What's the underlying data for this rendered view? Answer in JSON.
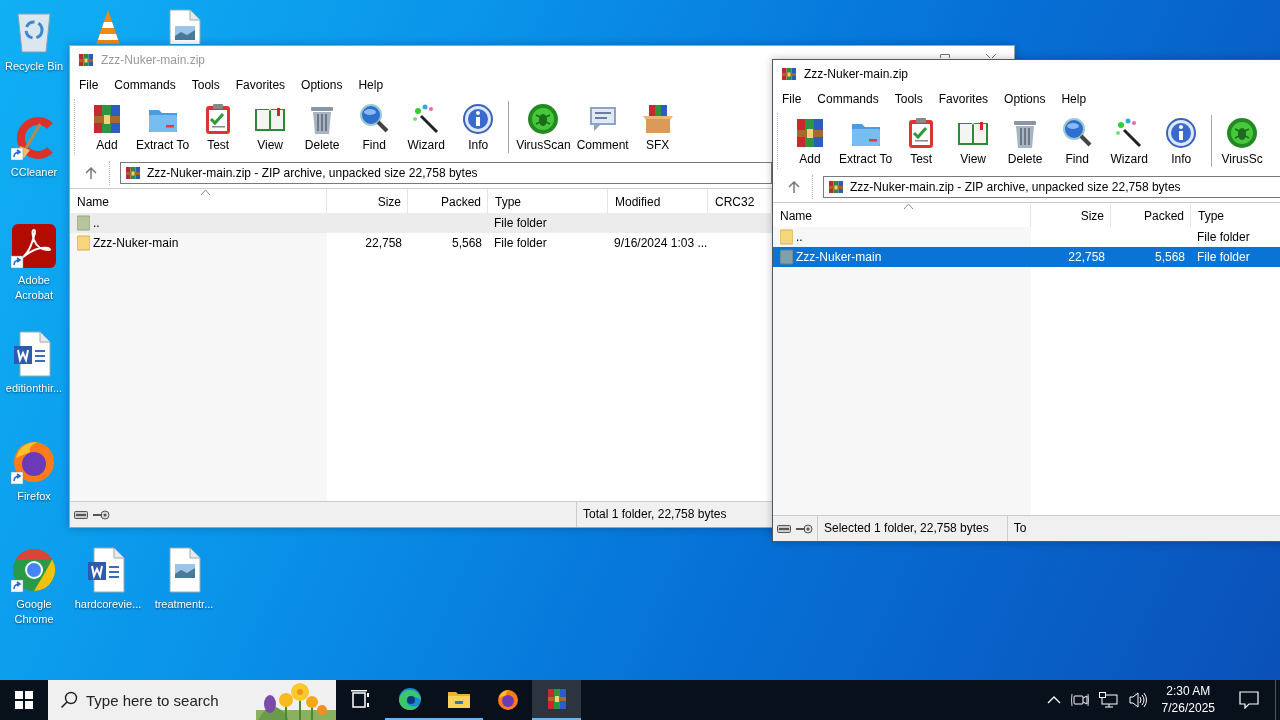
{
  "desktop_icons": [
    {
      "kind": "recycle-bin",
      "label": "Recycle Bin",
      "shortcut": false
    },
    {
      "kind": "vlc",
      "shortcut": false
    },
    {
      "kind": "image-file",
      "shortcut": false
    },
    {
      "kind": "ccleaner",
      "label": "CCleaner",
      "shortcut": true
    },
    {
      "kind": "acrobat",
      "label": "Adobe Acrobat",
      "shortcut": true
    },
    {
      "kind": "word-file",
      "label": "editionthir...",
      "shortcut": false
    },
    {
      "kind": "firefox",
      "label": "Firefox",
      "shortcut": true
    },
    {
      "kind": "chrome",
      "label": "Google Chrome",
      "shortcut": true
    },
    {
      "kind": "word-file",
      "label": "hardcorevie...",
      "shortcut": false
    },
    {
      "kind": "image-file",
      "label": "treatmentr...",
      "shortcut": false
    }
  ],
  "windows": [
    {
      "title": "Zzz-Nuker-main.zip",
      "active": false,
      "menu": [
        "File",
        "Commands",
        "Tools",
        "Favorites",
        "Options",
        "Help"
      ],
      "toolbar": [
        {
          "kind": "add",
          "label": "Add"
        },
        {
          "kind": "extract",
          "label": "Extract To"
        },
        {
          "kind": "test",
          "label": "Test"
        },
        {
          "kind": "view",
          "label": "View"
        },
        {
          "kind": "delete",
          "label": "Delete"
        },
        {
          "kind": "find",
          "label": "Find"
        },
        {
          "kind": "wizard",
          "label": "Wizard"
        },
        {
          "kind": "info",
          "label": "Info"
        },
        {
          "kind": "separator"
        },
        {
          "kind": "virusscan",
          "label": "VirusScan"
        },
        {
          "kind": "comment",
          "label": "Comment"
        },
        {
          "kind": "sfx",
          "label": "SFX"
        }
      ],
      "address": "Zzz-Nuker-main.zip - ZIP archive, unpacked size 22,758 bytes",
      "columns": [
        "Name",
        "Size",
        "Packed",
        "Type",
        "Modified",
        "CRC32"
      ],
      "rows": [
        {
          "name": "..",
          "type": "File folder",
          "selected": false,
          "highlighted": true
        },
        {
          "name": "Zzz-Nuker-main",
          "size": "22,758",
          "packed": "5,568",
          "type": "File folder",
          "modified": "9/16/2024 1:03 ...",
          "selected": false,
          "highlighted": false
        }
      ],
      "status": [
        "Total 1 folder, 22,758 bytes"
      ]
    },
    {
      "title": "Zzz-Nuker-main.zip",
      "active": true,
      "menu": [
        "File",
        "Commands",
        "Tools",
        "Favorites",
        "Options",
        "Help"
      ],
      "toolbar": [
        {
          "kind": "add",
          "label": "Add"
        },
        {
          "kind": "extract",
          "label": "Extract To"
        },
        {
          "kind": "test",
          "label": "Test"
        },
        {
          "kind": "view",
          "label": "View"
        },
        {
          "kind": "delete",
          "label": "Delete"
        },
        {
          "kind": "find",
          "label": "Find"
        },
        {
          "kind": "wizard",
          "label": "Wizard"
        },
        {
          "kind": "info",
          "label": "Info"
        },
        {
          "kind": "separator"
        },
        {
          "kind": "virusscan",
          "label": "VirusSc"
        }
      ],
      "address": "Zzz-Nuker-main.zip - ZIP archive, unpacked size 22,758 bytes",
      "columns": [
        "Name",
        "Size",
        "Packed",
        "Type"
      ],
      "rows": [
        {
          "name": "..",
          "type": "File folder",
          "selected": false,
          "highlighted": false
        },
        {
          "name": "Zzz-Nuker-main",
          "size": "22,758",
          "packed": "5,568",
          "type": "File folder",
          "selected": true,
          "highlighted": false
        }
      ],
      "status": [
        "Selected 1 folder, 22,758 bytes",
        "To"
      ]
    }
  ],
  "taskbar": {
    "search_placeholder": "Type here to search",
    "apps": [
      {
        "kind": "task-view",
        "running": false,
        "active": false
      },
      {
        "kind": "edge",
        "running": true,
        "active": false
      },
      {
        "kind": "explorer",
        "running": true,
        "active": false
      },
      {
        "kind": "firefox",
        "running": false,
        "active": false
      },
      {
        "kind": "archive",
        "running": true,
        "active": true
      }
    ],
    "time": "2:30 AM",
    "date": "7/26/2025"
  }
}
